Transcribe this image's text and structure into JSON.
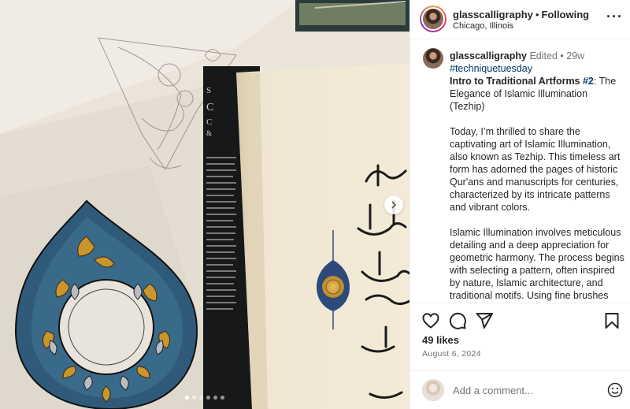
{
  "header": {
    "username": "glasscalligraphy",
    "separator": "•",
    "follow_status": "Following",
    "location": "Chicago, Illinois",
    "more_icon": "more-horizontal-icon"
  },
  "photo": {
    "carousel_dots": 6,
    "active_dot": 0,
    "next_icon": "chevron-right-icon"
  },
  "caption": {
    "username": "glasscalligraphy",
    "edited": "Edited",
    "separator": "•",
    "age": "29w",
    "hashtag": "#techniquetuesday",
    "title_bold": "Intro to Traditional Artforms ",
    "title_tag": "#2",
    "title_rest": ": The Elegance of Islamic Illumination (Tezhip)",
    "paragraph1": "Today, I’m thrilled to share the captivating art of Islamic Illumination, also known as Tezhip. This timeless art form has adorned the pages of historic Qur'ans and manuscripts for centuries, characterized by its intricate patterns and vibrant colors.",
    "paragraph2": "Islamic Illumination involves meticulous detailing and a deep appreciation for geometric harmony. The process begins with selecting a pattern, often inspired by nature, Islamic architecture, and traditional motifs. Using fine brushes and"
  },
  "actions": {
    "like_icon": "heart-icon",
    "comment_icon": "comment-icon",
    "share_icon": "send-icon",
    "save_icon": "bookmark-icon",
    "likes": "49 likes",
    "date": "August 6, 2024"
  },
  "comment_bar": {
    "placeholder": "Add a comment...",
    "emoji_icon": "emoji-smile-icon"
  },
  "colors": {
    "link": "#00376b",
    "muted": "#737373",
    "border": "#efefef"
  }
}
